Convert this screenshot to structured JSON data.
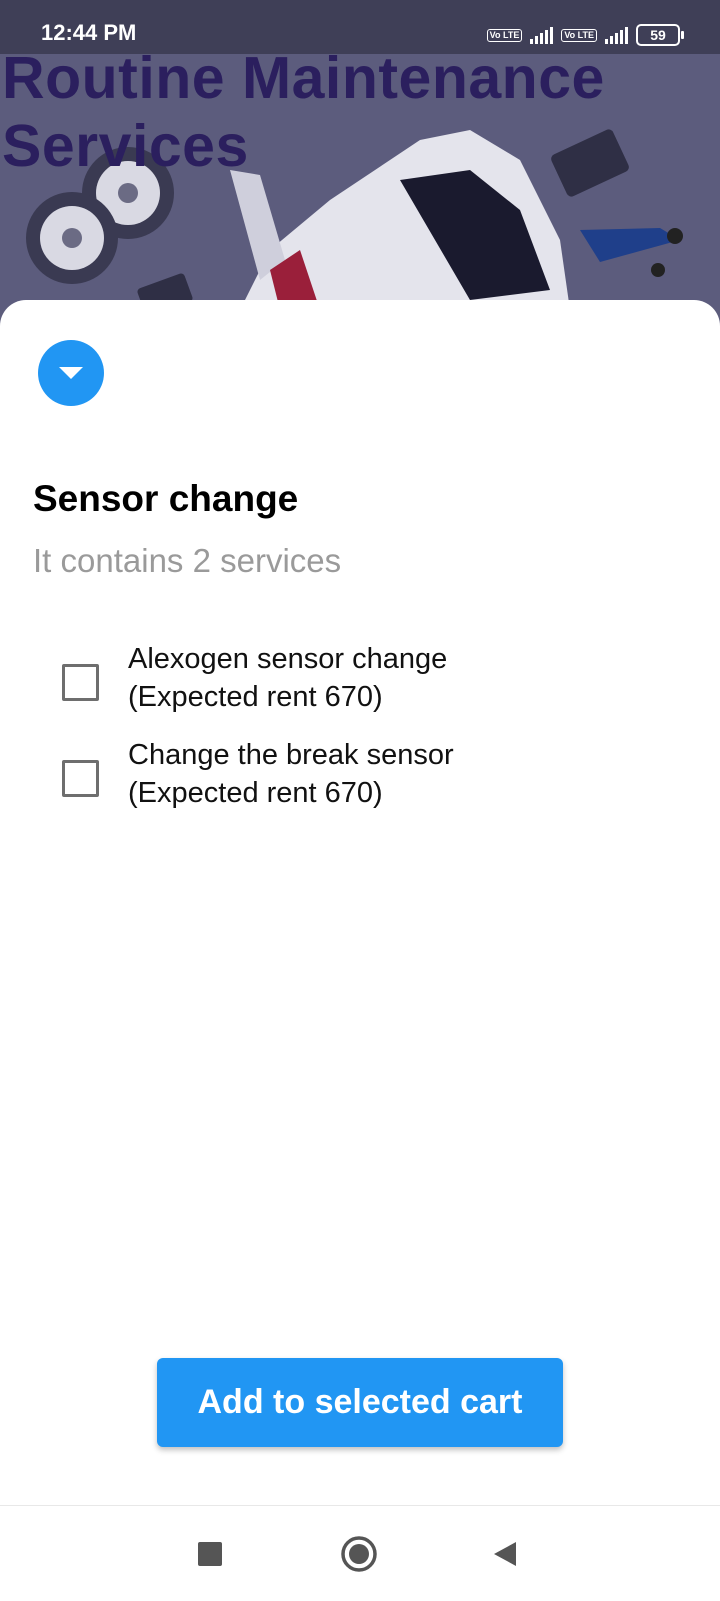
{
  "status_bar": {
    "time": "12:44 PM",
    "lte_1": "Vo LTE",
    "lte_2": "Vo LTE",
    "battery": "59"
  },
  "header": {
    "title": "Routine Maintenance Services"
  },
  "section": {
    "title": "Sensor change",
    "subtitle": "It contains 2 services"
  },
  "services": [
    {
      "line1": "Alexogen sensor change",
      "line2": "(Expected rent 670)",
      "checked": false
    },
    {
      "line1": "Change the break sensor",
      "line2": "(Expected rent 670)",
      "checked": false
    }
  ],
  "actions": {
    "add_to_cart": "Add to selected cart"
  },
  "icons": {
    "collapse": "chevron-down-icon",
    "nav_recent": "square-icon",
    "nav_home": "circle-icon",
    "nav_back": "triangle-back-icon"
  },
  "colors": {
    "accent": "#2196f3",
    "header_bg": "#5c5c7d",
    "title_color": "#2b1f5e"
  }
}
